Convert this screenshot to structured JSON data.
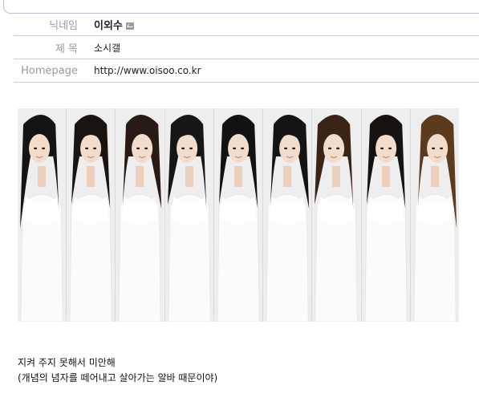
{
  "post": {
    "nickname_label": "닉네임",
    "nickname": "이외수",
    "subject_label": "제 목",
    "subject": "소시갤",
    "homepage_label": "Homepage",
    "homepage": "http://www.oisoo.co.kr"
  },
  "icons": {
    "nickname_mail": "mail-icon"
  },
  "image": {
    "panel_count": 9,
    "hair_colors": [
      "#141414",
      "#1a1410",
      "#2a1a14",
      "#161616",
      "#121212",
      "#141414",
      "#3a2418",
      "#161210",
      "#5c3a1e"
    ]
  },
  "content": {
    "line1": "지켜 주지 못해서 미안해",
    "line2": "(개념의 념자를 떼어내고 살아가는 알바 때문이야)"
  }
}
